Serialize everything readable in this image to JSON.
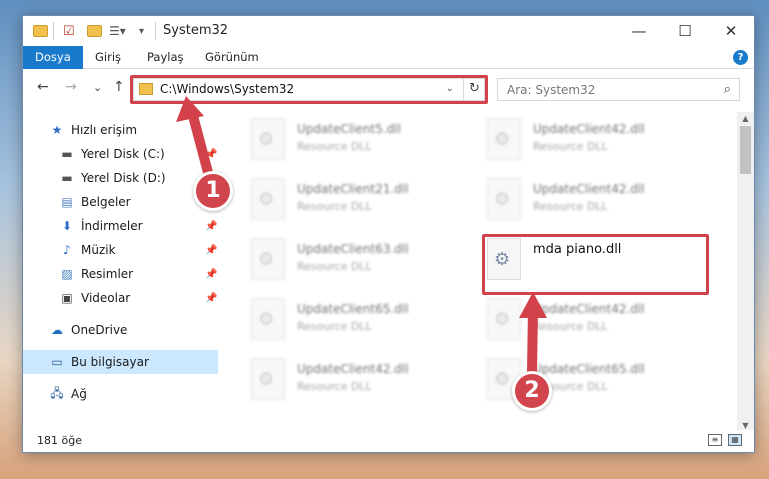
{
  "window": {
    "title": "System32",
    "controls": {
      "minimize": "—",
      "maximize": "☐",
      "close": "✕"
    }
  },
  "ribbon": {
    "tabs": [
      "Dosya",
      "Giriş",
      "Paylaş",
      "Görünüm"
    ],
    "active_tab": "Dosya",
    "help": "?"
  },
  "navigation": {
    "back": "←",
    "forward": "→",
    "recent": "⌄",
    "up": "↑",
    "address": "C:\\Windows\\System32",
    "refresh": "↻",
    "search_placeholder": "Ara: System32"
  },
  "sidebar": {
    "items": [
      {
        "label": "Hızlı erişim",
        "icon": "star-icon"
      },
      {
        "label": "Yerel Disk (C:)",
        "icon": "drive-icon"
      },
      {
        "label": "Yerel Disk (D:)",
        "icon": "drive-icon"
      },
      {
        "label": "Belgeler",
        "icon": "documents-icon"
      },
      {
        "label": "İndirmeler",
        "icon": "download-icon"
      },
      {
        "label": "Müzik",
        "icon": "music-icon"
      },
      {
        "label": "Resimler",
        "icon": "pictures-icon"
      },
      {
        "label": "Videolar",
        "icon": "video-icon"
      },
      {
        "label": "OneDrive",
        "icon": "cloud-icon"
      },
      {
        "label": "Bu bilgisayar",
        "icon": "computer-icon"
      },
      {
        "label": "Ağ",
        "icon": "network-icon"
      }
    ]
  },
  "files": [
    {
      "name": "UpdateClient5.dll",
      "type": "Resource DLL"
    },
    {
      "name": "UpdateClient42.dll",
      "type": "Resource DLL"
    },
    {
      "name": "UpdateClient21.dll",
      "type": "Resource DLL"
    },
    {
      "name": "UpdateClient42.dll",
      "type": "Resource DLL"
    },
    {
      "name": "UpdateClient63.dll",
      "type": "Resource DLL"
    },
    {
      "name": "mda piano.dll",
      "type": ""
    },
    {
      "name": "UpdateClient65.dll",
      "type": "Resource DLL"
    },
    {
      "name": "UpdateClient42.dll",
      "type": "Resource DLL"
    },
    {
      "name": "UpdateClient42.dll",
      "type": "Resource DLL"
    },
    {
      "name": "UpdateClient65.dll",
      "type": "Resource DLL"
    }
  ],
  "status": {
    "count": "181 öğe"
  },
  "annotations": {
    "badge1": "1",
    "badge2": "2",
    "color": "#d3424a"
  }
}
